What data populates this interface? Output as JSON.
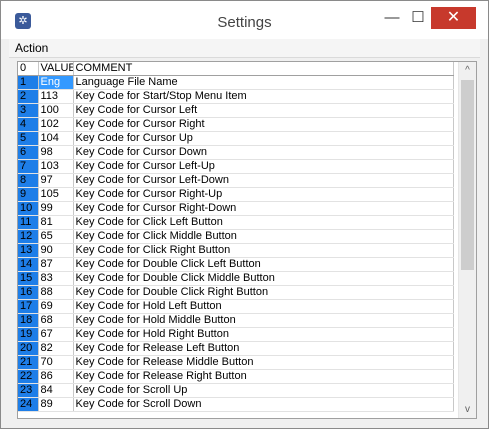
{
  "window": {
    "title": "Settings",
    "app_icon": "gear-star-icon",
    "controls": {
      "minimize": "—",
      "maximize": "☐",
      "close": "✕"
    }
  },
  "menu": {
    "items": [
      "Action"
    ]
  },
  "grid": {
    "columns": [
      "0",
      "VALUE",
      "COMMENT"
    ],
    "rows": [
      {
        "idx": "1",
        "value": "Eng",
        "comment": "Language File Name"
      },
      {
        "idx": "2",
        "value": "113",
        "comment": "Key Code for Start/Stop Menu Item"
      },
      {
        "idx": "3",
        "value": "100",
        "comment": "Key Code for Cursor Left"
      },
      {
        "idx": "4",
        "value": "102",
        "comment": "Key Code for Cursor Right"
      },
      {
        "idx": "5",
        "value": "104",
        "comment": "Key Code for Cursor Up"
      },
      {
        "idx": "6",
        "value": "98",
        "comment": "Key Code for Cursor Down"
      },
      {
        "idx": "7",
        "value": "103",
        "comment": "Key Code for Cursor Left-Up"
      },
      {
        "idx": "8",
        "value": "97",
        "comment": "Key Code for Cursor Left-Down"
      },
      {
        "idx": "9",
        "value": "105",
        "comment": "Key Code for Cursor Right-Up"
      },
      {
        "idx": "10",
        "value": "99",
        "comment": "Key Code for Cursor Right-Down"
      },
      {
        "idx": "11",
        "value": "81",
        "comment": "Key Code for Click Left Button"
      },
      {
        "idx": "12",
        "value": "65",
        "comment": "Key Code for Click Middle Button"
      },
      {
        "idx": "13",
        "value": "90",
        "comment": "Key Code for Click Right Button"
      },
      {
        "idx": "14",
        "value": "87",
        "comment": "Key Code for Double Click Left Button"
      },
      {
        "idx": "15",
        "value": "83",
        "comment": "Key Code for Double Click Middle Button"
      },
      {
        "idx": "16",
        "value": "88",
        "comment": "Key Code for Double Click Right Button"
      },
      {
        "idx": "17",
        "value": "69",
        "comment": "Key Code for Hold Left Button"
      },
      {
        "idx": "18",
        "value": "68",
        "comment": "Key Code for Hold Middle Button"
      },
      {
        "idx": "19",
        "value": "67",
        "comment": "Key Code for Hold Right Button"
      },
      {
        "idx": "20",
        "value": "82",
        "comment": "Key Code for Release Left Button"
      },
      {
        "idx": "21",
        "value": "70",
        "comment": "Key Code for Release Middle Button"
      },
      {
        "idx": "22",
        "value": "86",
        "comment": "Key Code for Release Right Button"
      },
      {
        "idx": "23",
        "value": "84",
        "comment": "Key Code for Scroll Up"
      },
      {
        "idx": "24",
        "value": "89",
        "comment": "Key Code for Scroll Down"
      }
    ],
    "selected_row": 0
  },
  "scrollbar": {
    "up": "^",
    "down": "v"
  },
  "colors": {
    "index_column": "#1e7ee8",
    "selection": "#3399ff",
    "close_button": "#c7392c"
  }
}
